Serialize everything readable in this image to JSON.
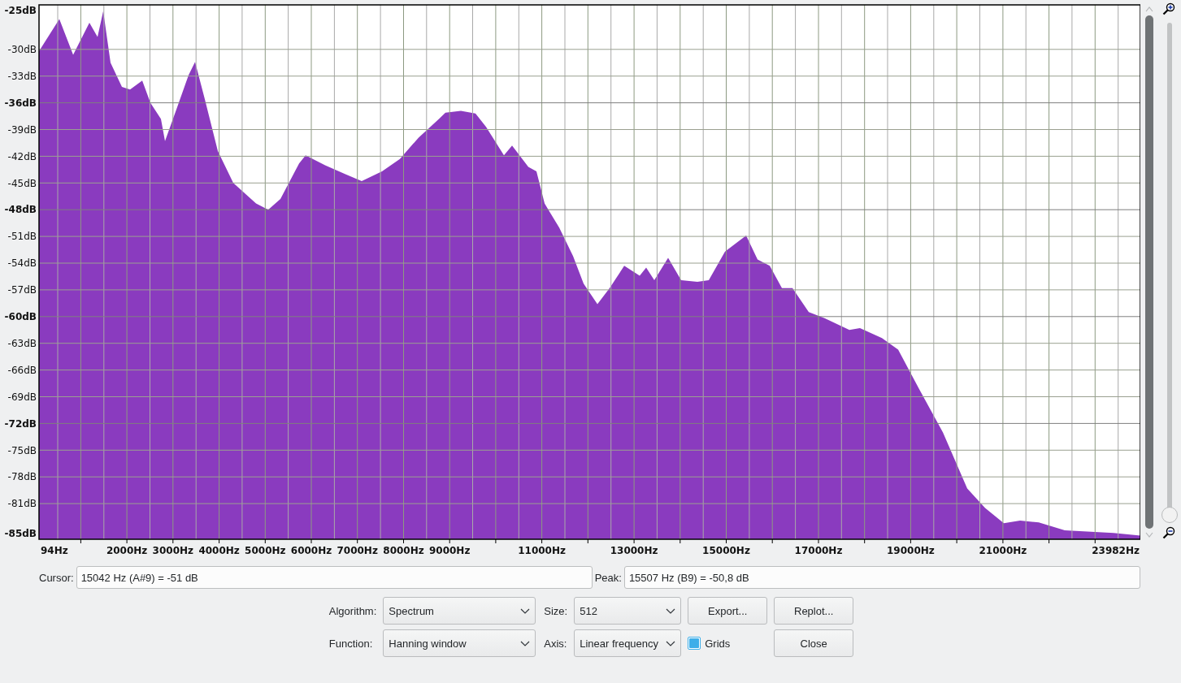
{
  "chart": {
    "chart_data": {
      "type": "area",
      "x": [
        94,
        535,
        834,
        1187,
        1363,
        1487,
        1645,
        1892,
        2069,
        2333,
        2509,
        2739,
        2827,
        3091,
        3338,
        3479,
        3691,
        3973,
        4308,
        4801,
        5066,
        5330,
        5736,
        5877,
        6300,
        6741,
        7093,
        7534,
        7922,
        8327,
        8768,
        8909,
        9244,
        9561,
        9791,
        10178,
        10355,
        10707,
        10884,
        11060,
        11377,
        11677,
        11906,
        12206,
        12470,
        12788,
        13122,
        13264,
        13440,
        13740,
        14022,
        14374,
        14621,
        14974,
        15432,
        15679,
        15943,
        16208,
        16437,
        16790,
        17142,
        17671,
        17900,
        18376,
        18729,
        19170,
        19699,
        20227,
        20615,
        21021,
        21373,
        21779,
        22343,
        23401,
        23982
      ],
      "series": [
        {
          "color": "#8a3bbf",
          "values": [
            -30.2,
            -26.6,
            -30.6,
            -27.0,
            -28.6,
            -25.7,
            -31.5,
            -34.2,
            -34.5,
            -33.5,
            -36.0,
            -37.8,
            -40.3,
            -36.5,
            -32.9,
            -31.4,
            -35.6,
            -41.4,
            -45.0,
            -47.3,
            -48.0,
            -46.8,
            -42.8,
            -41.9,
            -43.0,
            -44.0,
            -44.8,
            -43.7,
            -42.3,
            -39.9,
            -37.8,
            -37.1,
            -36.9,
            -37.2,
            -38.7,
            -41.9,
            -40.8,
            -43.2,
            -43.7,
            -47.3,
            -50.0,
            -53.2,
            -56.3,
            -58.6,
            -56.8,
            -54.3,
            -55.4,
            -54.5,
            -55.9,
            -53.4,
            -55.9,
            -56.1,
            -55.9,
            -52.7,
            -50.9,
            -53.6,
            -54.3,
            -56.8,
            -56.8,
            -59.5,
            -60.2,
            -61.5,
            -61.3,
            -62.4,
            -63.7,
            -68.0,
            -73.0,
            -79.3,
            -81.5,
            -83.2,
            -82.9,
            -83.1,
            -84.0,
            -84.3,
            -84.6
          ]
        }
      ],
      "xlim": [
        94,
        23982
      ],
      "ylim": [
        -85,
        -25
      ],
      "grid": true,
      "xticks": [
        {
          "value": 94,
          "label": "94Hz"
        },
        {
          "value": 2000,
          "label": "2000Hz"
        },
        {
          "value": 3000,
          "label": "3000Hz"
        },
        {
          "value": 4000,
          "label": "4000Hz"
        },
        {
          "value": 5000,
          "label": "5000Hz"
        },
        {
          "value": 6000,
          "label": "6000Hz"
        },
        {
          "value": 7000,
          "label": "7000Hz"
        },
        {
          "value": 8000,
          "label": "8000Hz"
        },
        {
          "value": 9000,
          "label": "9000Hz"
        },
        {
          "value": 11000,
          "label": "11000Hz"
        },
        {
          "value": 13000,
          "label": "13000Hz"
        },
        {
          "value": 15000,
          "label": "15000Hz"
        },
        {
          "value": 17000,
          "label": "17000Hz"
        },
        {
          "value": 19000,
          "label": "19000Hz"
        },
        {
          "value": 21000,
          "label": "21000Hz"
        },
        {
          "value": 23982,
          "label": "23982Hz"
        }
      ],
      "yticks": [
        {
          "value": -25,
          "label": "-25dB"
        },
        {
          "value": -30,
          "label": "-30dB"
        },
        {
          "value": -33,
          "label": "-33dB"
        },
        {
          "value": -36,
          "label": "-36dB"
        },
        {
          "value": -39,
          "label": "-39dB"
        },
        {
          "value": -42,
          "label": "-42dB"
        },
        {
          "value": -45,
          "label": "-45dB"
        },
        {
          "value": -48,
          "label": "-48dB"
        },
        {
          "value": -51,
          "label": "-51dB"
        },
        {
          "value": -54,
          "label": "-54dB"
        },
        {
          "value": -57,
          "label": "-57dB"
        },
        {
          "value": -60,
          "label": "-60dB"
        },
        {
          "value": -63,
          "label": "-63dB"
        },
        {
          "value": -66,
          "label": "-66dB"
        },
        {
          "value": -69,
          "label": "-69dB"
        },
        {
          "value": -72,
          "label": "-72dB"
        },
        {
          "value": -75,
          "label": "-75dB"
        },
        {
          "value": -78,
          "label": "-78dB"
        },
        {
          "value": -81,
          "label": "-81dB"
        },
        {
          "value": -85,
          "label": "-85dB"
        }
      ]
    }
  },
  "zoom": {
    "level": 0
  },
  "cursor": {
    "label": "Cursor:",
    "value": "15042 Hz (A#9) = -51 dB"
  },
  "peak": {
    "label": "Peak:",
    "value": "15507 Hz (B9) = -50,8 dB"
  },
  "algorithm": {
    "label": "Algorithm:",
    "value": "Spectrum"
  },
  "size": {
    "label": "Size:",
    "value": "512"
  },
  "function": {
    "label": "Function:",
    "value": "Hanning window"
  },
  "axis": {
    "label": "Axis:",
    "value": "Linear frequency"
  },
  "grids": {
    "label": "Grids",
    "checked": true
  },
  "buttons": [
    {
      "label": "Export..."
    },
    {
      "label": "Replot..."
    },
    {
      "label": "Close"
    }
  ]
}
